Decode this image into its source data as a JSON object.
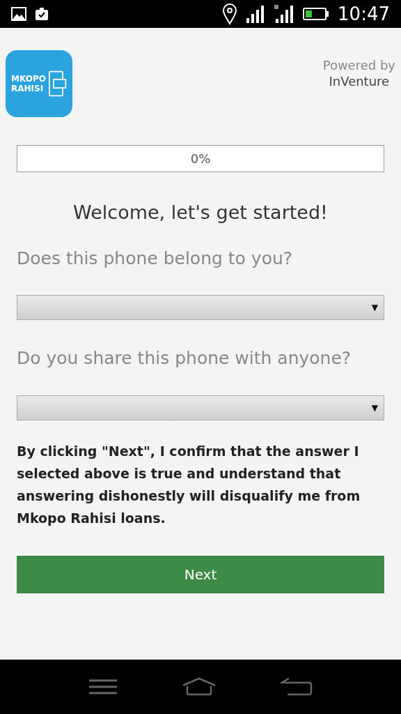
{
  "status_bar": {
    "time": "10:47"
  },
  "header": {
    "logo_text": [
      "MKOPO",
      "RAHISI"
    ],
    "powered_by": "Powered by",
    "company": "InVenture"
  },
  "progress": {
    "level": 0,
    "label": "0%"
  },
  "title": "Welcome, let's get started!",
  "questions": [
    {
      "label": "Does this phone belong to you?",
      "arrow": "▼"
    },
    {
      "label": "Do you share this phone with anyone?",
      "arrow": "▼"
    }
  ],
  "disclaimer": "By clicking \"Next\", I confirm that the answer I selected above is true and understand that answering dishonestly will disqualify me from Mkopo Rahisi loans.",
  "next_button": "Next"
}
